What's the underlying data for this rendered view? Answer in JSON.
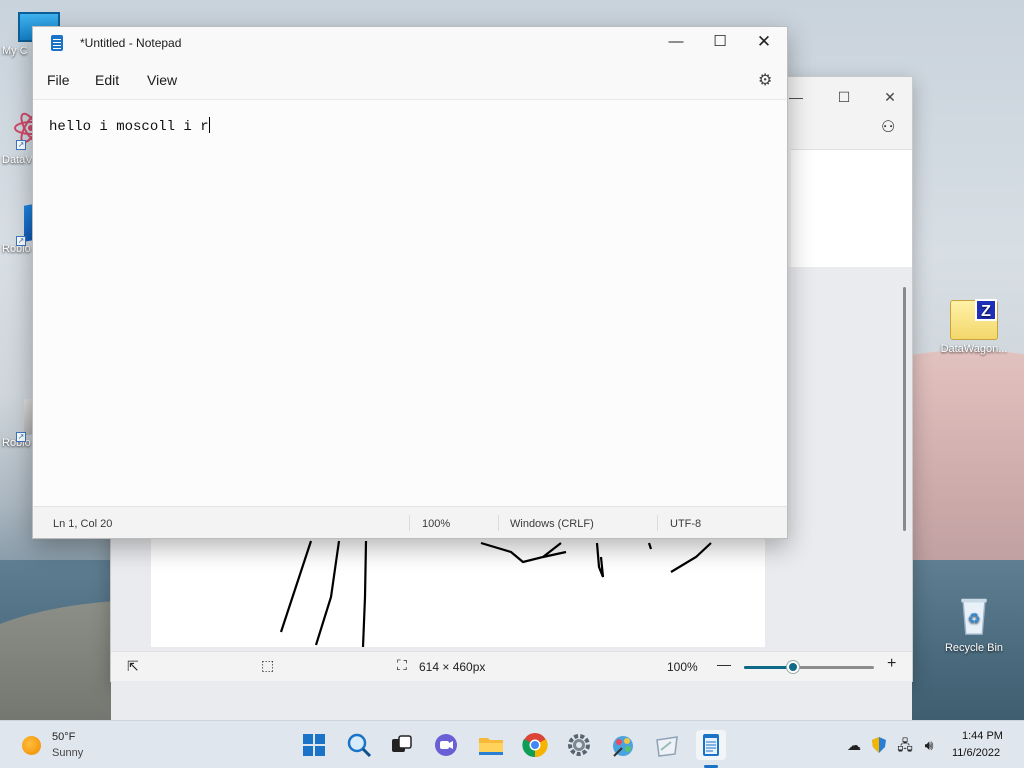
{
  "desktop": {
    "icons_left": [
      {
        "label": "My C",
        "icon": "monitor-icon"
      },
      {
        "label": "DataV",
        "icon": "atom-icon"
      },
      {
        "label": "Roblo",
        "icon": "roblox-icon"
      },
      {
        "label": "Roblo",
        "icon": "roblox-icon"
      }
    ],
    "icons_right": [
      {
        "label": "DataWagon...",
        "icon": "zip-folder-icon"
      },
      {
        "label": "Recycle Bin",
        "icon": "recycle-bin-icon"
      }
    ]
  },
  "paint": {
    "status": {
      "canvas_size": "614 × 460px",
      "zoom": "100%",
      "zoom_fraction": 0.38
    }
  },
  "notepad": {
    "title": "*Untitled - Notepad",
    "menu": [
      "File",
      "Edit",
      "View"
    ],
    "content": "hello i moscoll i r",
    "status": {
      "position": "Ln 1, Col 20",
      "zoom": "100%",
      "line_ending": "Windows (CRLF)",
      "encoding": "UTF-8"
    }
  },
  "taskbar": {
    "weather": {
      "temp": "50°F",
      "desc": "Sunny"
    },
    "apps": [
      "start-icon",
      "search-icon",
      "task-view-icon",
      "chat-icon",
      "file-explorer-icon",
      "chrome-icon",
      "settings-icon",
      "app-icon",
      "paint-icon",
      "notepad-icon"
    ],
    "clock": {
      "time": "1:44 PM",
      "date": "11/6/2022"
    }
  },
  "colors": {
    "accent": "#1a73c7",
    "zoom_slider": "#0f6a8a"
  }
}
